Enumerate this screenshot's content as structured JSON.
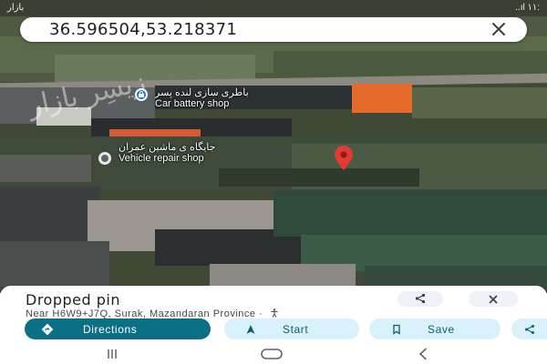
{
  "status_bar": {
    "left_text": "ﺑﺎﺯﺍﺭ",
    "right_text": "..ıl ۱۱:"
  },
  "search": {
    "value": "36.596504,53.218371",
    "close_icon": "close-icon"
  },
  "map": {
    "watermark": "زیسِر بازار",
    "places": [
      {
        "name_fa": "باطری سازی لنده پسر",
        "name_en": "Car battery shop",
        "icon": "shopping-bag-icon",
        "color": "#1a73e8"
      },
      {
        "name_fa": "جایگاه ی ماشین عمران",
        "name_en": "Vehicle repair shop",
        "icon": "place-dot-icon",
        "color": "#5f6368"
      }
    ],
    "pin_color": "#e53935"
  },
  "sheet": {
    "title": "Dropped pin",
    "subtitle": "Near H6W9+J7Q, Surak, Mazandaran Province ·",
    "share_icon": "share-icon",
    "close_icon": "close-icon",
    "buttons": {
      "directions": "Directions",
      "start": "Start",
      "save": "Save"
    }
  },
  "colors": {
    "accent": "#0b6f86",
    "chip_bg": "#d9f1f8"
  }
}
